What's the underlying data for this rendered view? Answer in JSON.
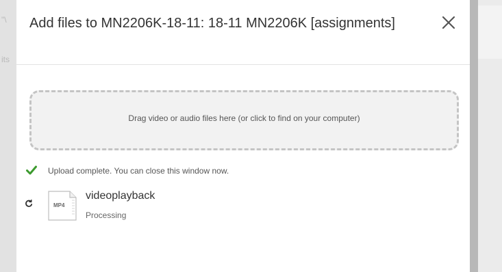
{
  "background": {
    "left_fragments": [
      "\"\\",
      "its"
    ]
  },
  "modal": {
    "title": "Add files to MN2206K-18-11: 18-11 MN2206K [assignments]",
    "close_icon": "close-icon"
  },
  "dropzone": {
    "label": "Drag video or audio files here (or click to find on your computer)"
  },
  "status": {
    "icon": "check-icon",
    "text": "Upload complete. You can close this window now.",
    "color": "#3c9a2e"
  },
  "files": [
    {
      "status_icon": "refresh-icon",
      "type_label": "MP4",
      "name": "videoplayback",
      "status": "Processing"
    }
  ]
}
